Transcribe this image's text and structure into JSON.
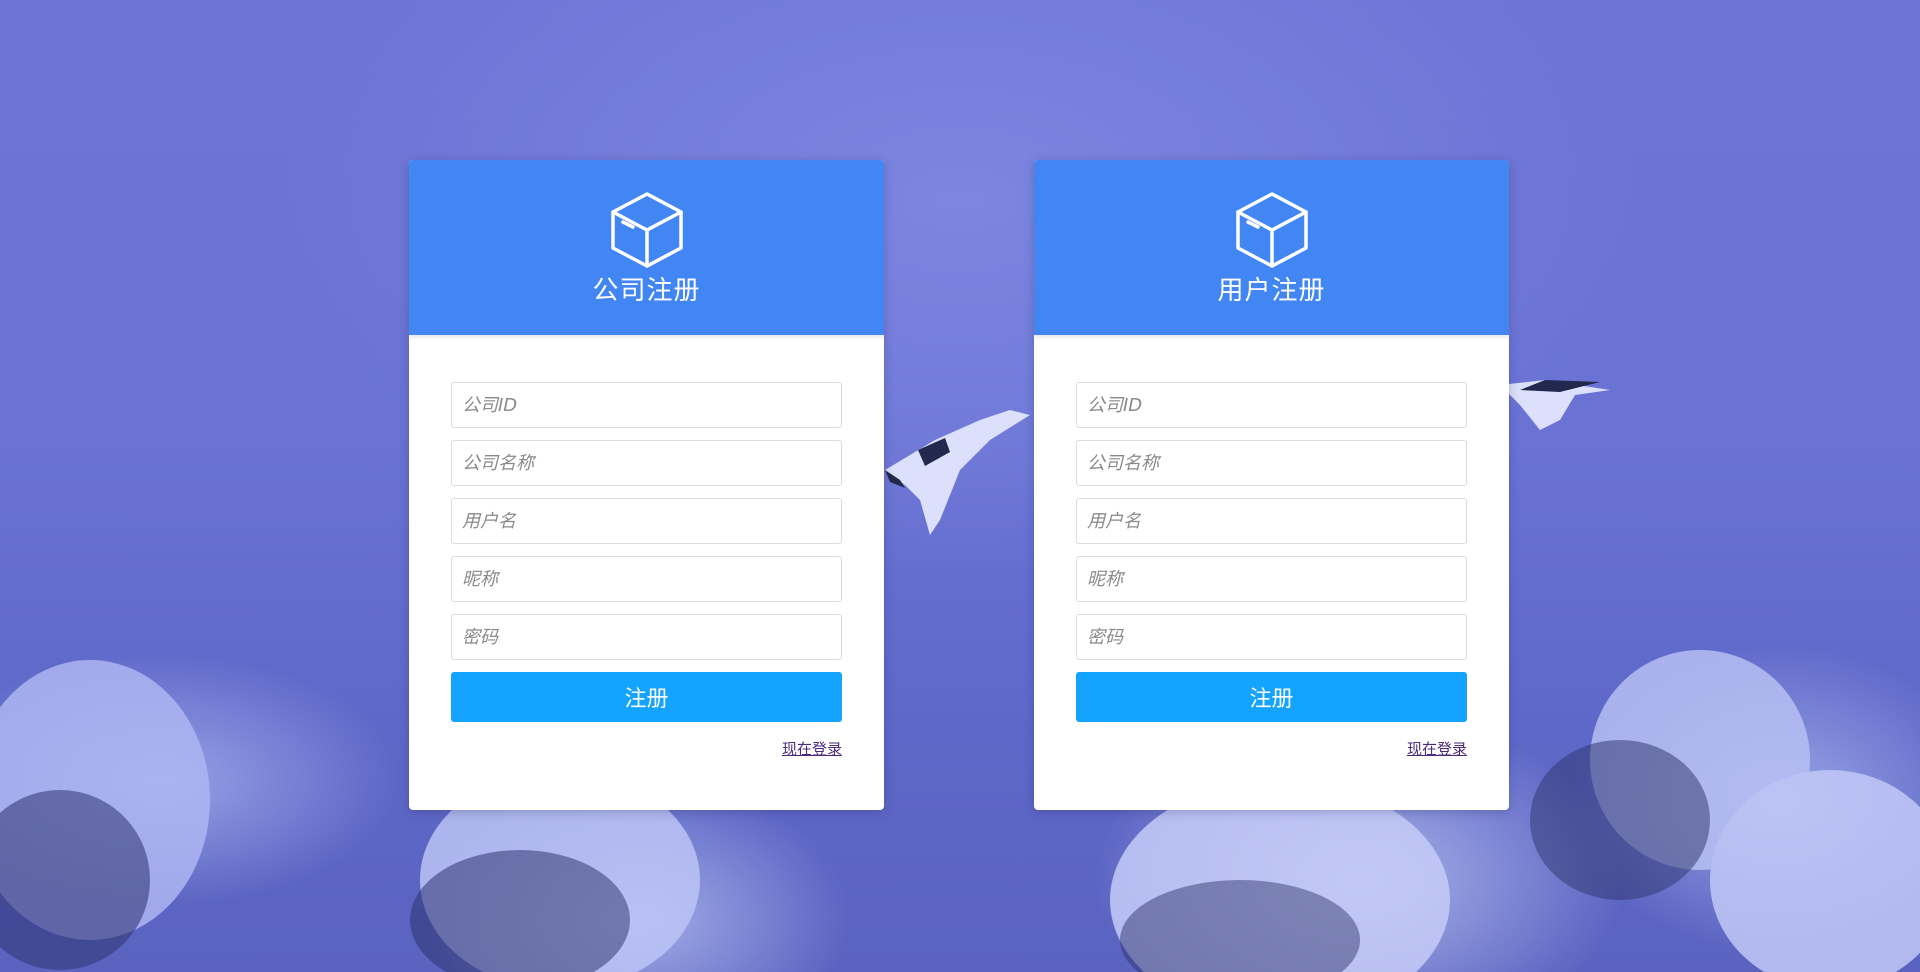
{
  "company_form": {
    "title": "公司注册",
    "fields": [
      {
        "placeholder": "公司ID"
      },
      {
        "placeholder": "公司名称"
      },
      {
        "placeholder": "用户名"
      },
      {
        "placeholder": "昵称"
      },
      {
        "placeholder": "密码"
      }
    ],
    "submit_label": "注册",
    "login_link": "现在登录",
    "icon": "box-icon"
  },
  "user_form": {
    "title": "用户注册",
    "fields": [
      {
        "placeholder": "公司ID"
      },
      {
        "placeholder": "公司名称"
      },
      {
        "placeholder": "用户名"
      },
      {
        "placeholder": "昵称"
      },
      {
        "placeholder": "密码"
      }
    ],
    "submit_label": "注册",
    "login_link": "现在登录",
    "icon": "box-icon"
  },
  "colors": {
    "header": "#4286f4",
    "button": "#14a3ff",
    "background": "#6c74d6"
  }
}
